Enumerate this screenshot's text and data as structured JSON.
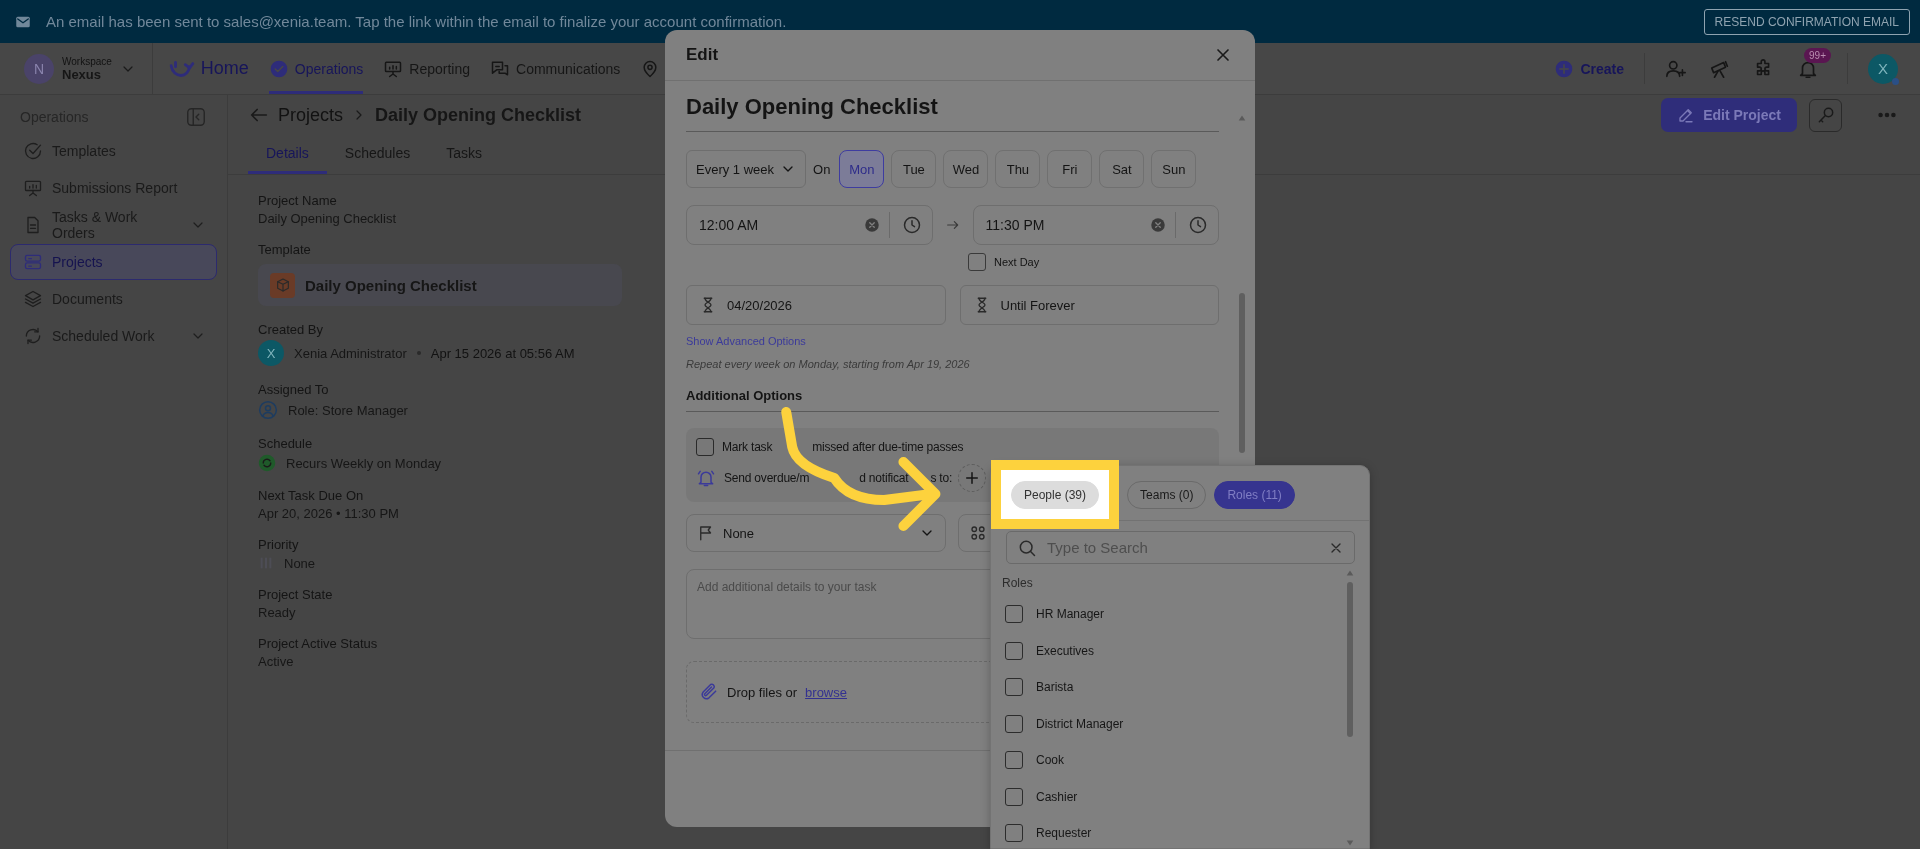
{
  "banner": {
    "message": "An email has been sent to sales@xenia.team. Tap the link within the email to finalize your account confirmation.",
    "button": "RESEND CONFIRMATION EMAIL"
  },
  "header": {
    "workspace_initial": "N",
    "workspace_label": "Workspace",
    "workspace_name": "Nexus",
    "nav": [
      {
        "label": "Home",
        "kind": "brand",
        "selected": false
      },
      {
        "label": "Operations",
        "kind": "nav",
        "selected": true
      },
      {
        "label": "Reporting",
        "kind": "nav",
        "selected": false
      },
      {
        "label": "Communications",
        "kind": "nav",
        "selected": false
      }
    ],
    "create": "Create",
    "badge": "99+",
    "avatar": "X"
  },
  "sidebar": {
    "title": "Operations",
    "items": [
      {
        "label": "Templates",
        "selected": false,
        "expandable": false
      },
      {
        "label": "Submissions Report",
        "selected": false,
        "expandable": false
      },
      {
        "label": "Tasks & Work Orders",
        "selected": false,
        "expandable": true
      },
      {
        "label": "Projects",
        "selected": true,
        "expandable": false
      },
      {
        "label": "Documents",
        "selected": false,
        "expandable": false
      },
      {
        "label": "Scheduled Work",
        "selected": false,
        "expandable": true
      }
    ]
  },
  "breadcrumb": {
    "parent": "Projects",
    "current": "Daily Opening Checklist"
  },
  "edit_button": "Edit Project",
  "tabs": [
    {
      "label": "Details",
      "selected": true
    },
    {
      "label": "Schedules",
      "selected": false
    },
    {
      "label": "Tasks",
      "selected": false
    }
  ],
  "details": [
    {
      "label": "Project Name",
      "kind": "text",
      "value": "Daily Opening Checklist"
    },
    {
      "label": "Template",
      "kind": "template",
      "value": "Daily Opening Checklist"
    },
    {
      "label": "Created By",
      "kind": "creator",
      "avatar": "X",
      "value": "Xenia Administrator",
      "date": "Apr 15 2026 at 05:56 AM"
    },
    {
      "label": "Assigned To",
      "kind": "role",
      "value": "Role: Store Manager"
    },
    {
      "label": "Schedule",
      "kind": "schedule",
      "value": "Recurs Weekly on Monday"
    },
    {
      "label": "Next Task Due On",
      "kind": "text",
      "value": "Apr 20, 2026 • 11:30 PM"
    },
    {
      "label": "Priority",
      "kind": "priority",
      "value": "None"
    },
    {
      "label": "Project State",
      "kind": "text",
      "value": "Ready"
    },
    {
      "label": "Project Active Status",
      "kind": "text",
      "value": "Active"
    }
  ],
  "modal": {
    "title": "Edit",
    "task_title": "Daily Opening Checklist",
    "frequency": "Every 1 week",
    "on_label": "On",
    "days": [
      {
        "label": "Mon",
        "selected": true
      },
      {
        "label": "Tue",
        "selected": false
      },
      {
        "label": "Wed",
        "selected": false
      },
      {
        "label": "Thu",
        "selected": false
      },
      {
        "label": "Fri",
        "selected": false
      },
      {
        "label": "Sat",
        "selected": false
      },
      {
        "label": "Sun",
        "selected": false
      }
    ],
    "start_time": "12:00 AM",
    "end_time": "11:30 PM",
    "next_day": {
      "label": "Next Day",
      "checked": false
    },
    "start_date": "04/20/2026",
    "end_date": "Until Forever",
    "advanced_link": "Show Advanced Options",
    "summary": "Repeat every week on Monday, starting from Apr 19, 2026",
    "additional_title": "Additional Options",
    "mark_missed": {
      "label_parts": [
        "Mark task",
        "missed after due-time passes"
      ],
      "checked": false
    },
    "notify_label_parts": [
      "Send overdue/m",
      "d notificat",
      "s to:"
    ],
    "priority": "None",
    "details_placeholder": "Add additional details to your task",
    "attach_text": "Drop files or",
    "attach_link": "browse"
  },
  "assignee_popover": {
    "tabs": [
      {
        "label": "People (39)",
        "selected": false,
        "highlighted": true
      },
      {
        "label": "Teams (0)",
        "selected": false,
        "highlighted": false
      },
      {
        "label": "Roles (11)",
        "selected": true,
        "highlighted": false
      }
    ],
    "search_placeholder": "Type to Search",
    "section": "Roles",
    "options": [
      {
        "label": "HR Manager",
        "checked": false
      },
      {
        "label": "Executives",
        "checked": false
      },
      {
        "label": "Barista",
        "checked": false
      },
      {
        "label": "District Manager",
        "checked": false
      },
      {
        "label": "Cook",
        "checked": false
      },
      {
        "label": "Cashier",
        "checked": false
      },
      {
        "label": "Requester",
        "checked": false
      }
    ]
  }
}
